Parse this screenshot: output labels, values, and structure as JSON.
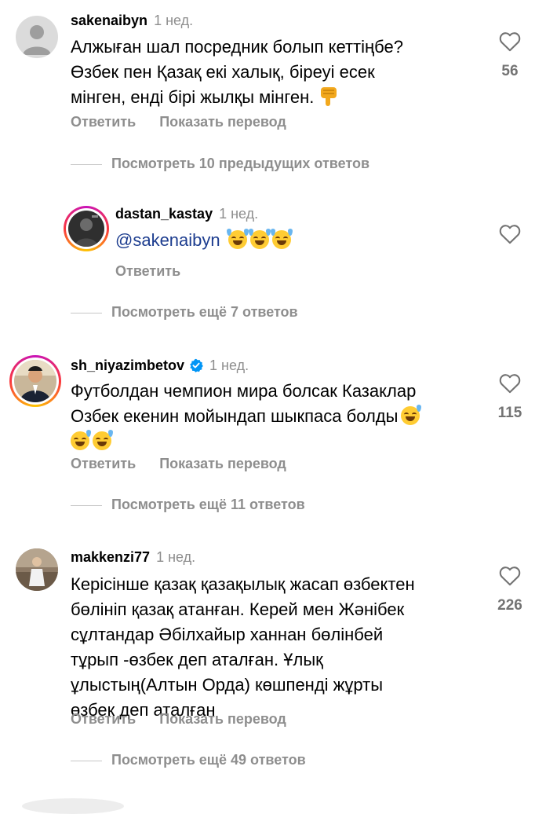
{
  "comments": [
    {
      "username": "sakenaibyn",
      "time": "1 нед.",
      "lines": [
        "Алжыған шал посредник болып кеттіңбе?",
        "Өзбек пен Қазақ екі халық, біреуі есек",
        "мінген, енді бірі жылқы мінген."
      ],
      "emoji": "thumbs-down",
      "likes": "56",
      "reply_label": "Ответить",
      "translate_label": "Показать перевод",
      "view_replies": "Посмотреть 10 предыдущих ответов"
    },
    {
      "username": "dastan_kastay",
      "time": "1 нед.",
      "mention": "@sakenaibyn",
      "emoji": "tears-of-joy x3",
      "reply_label": "Ответить",
      "view_replies": "Посмотреть ещё 7 ответов"
    },
    {
      "username": "sh_niyazimbetov",
      "time": "1 нед.",
      "verified": true,
      "lines": [
        "Футболдан чемпион мира болсак Казаклар",
        "Озбек екенин мойындап шыкпаса болды"
      ],
      "emoji": "grinning-sweat x3",
      "likes": "115",
      "reply_label": "Ответить",
      "translate_label": "Показать перевод",
      "view_replies": "Посмотреть ещё 11 ответов"
    },
    {
      "username": "makkenzi77",
      "time": "1 нед.",
      "lines": [
        "Керісінше қазақ қазақылық жасап өзбектен",
        "бөлініп қазақ атанған. Керей мен Жәнібек",
        "сұлтандар Әбілхайыр ханнан бөлінбей",
        "тұрып -өзбек деп аталған. Ұлық",
        "ұлыстың(Алтын Орда) көшпенді жұрты",
        "өзбек деп аталған"
      ],
      "likes": "226",
      "reply_label": "Ответить",
      "translate_label": "Показать перевод",
      "view_replies": "Посмотреть ещё 49 ответов"
    }
  ],
  "colors": {
    "muted": "#8e8e8e",
    "mention": "#1d3d8f",
    "verified": "#0095f6"
  },
  "icons": [
    "heart-outline-icon",
    "verified-badge-icon",
    "thumbs-down-emoji",
    "tears-of-joy-emoji",
    "grinning-sweat-emoji"
  ]
}
